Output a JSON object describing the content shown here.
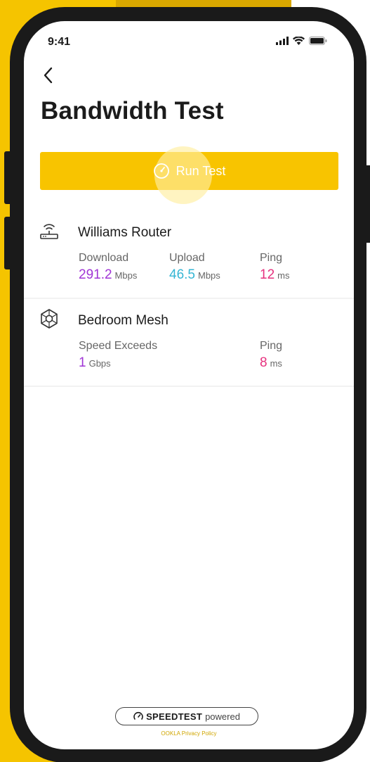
{
  "status_bar": {
    "time": "9:41"
  },
  "header": {
    "title": "Bandwidth Test",
    "back_icon": "chevron-left-icon"
  },
  "run_button": {
    "label": "Run Test",
    "icon": "speedometer-icon"
  },
  "devices": [
    {
      "name": "Williams Router",
      "icon": "router-icon",
      "metrics": [
        {
          "label": "Download",
          "value": "291.2",
          "unit": "Mbps",
          "color": "#a035d6"
        },
        {
          "label": "Upload",
          "value": "46.5",
          "unit": "Mbps",
          "color": "#36b6d4"
        },
        {
          "label": "Ping",
          "value": "12",
          "unit": "ms",
          "color": "#e6317e"
        }
      ]
    },
    {
      "name": "Bedroom Mesh",
      "icon": "mesh-node-icon",
      "metrics": [
        {
          "label": "Speed Exceeds",
          "value": "1",
          "unit": "Gbps",
          "color": "#a035d6"
        },
        {
          "label": "Ping",
          "value": "8",
          "unit": "ms",
          "color": "#e6317e"
        }
      ]
    }
  ],
  "footer": {
    "logo_bold": "SPEEDTEST",
    "logo_light": "powered",
    "link": "OOKLA Privacy Policy"
  },
  "colors": {
    "accent": "#f8c400",
    "background": "#f5c400"
  }
}
